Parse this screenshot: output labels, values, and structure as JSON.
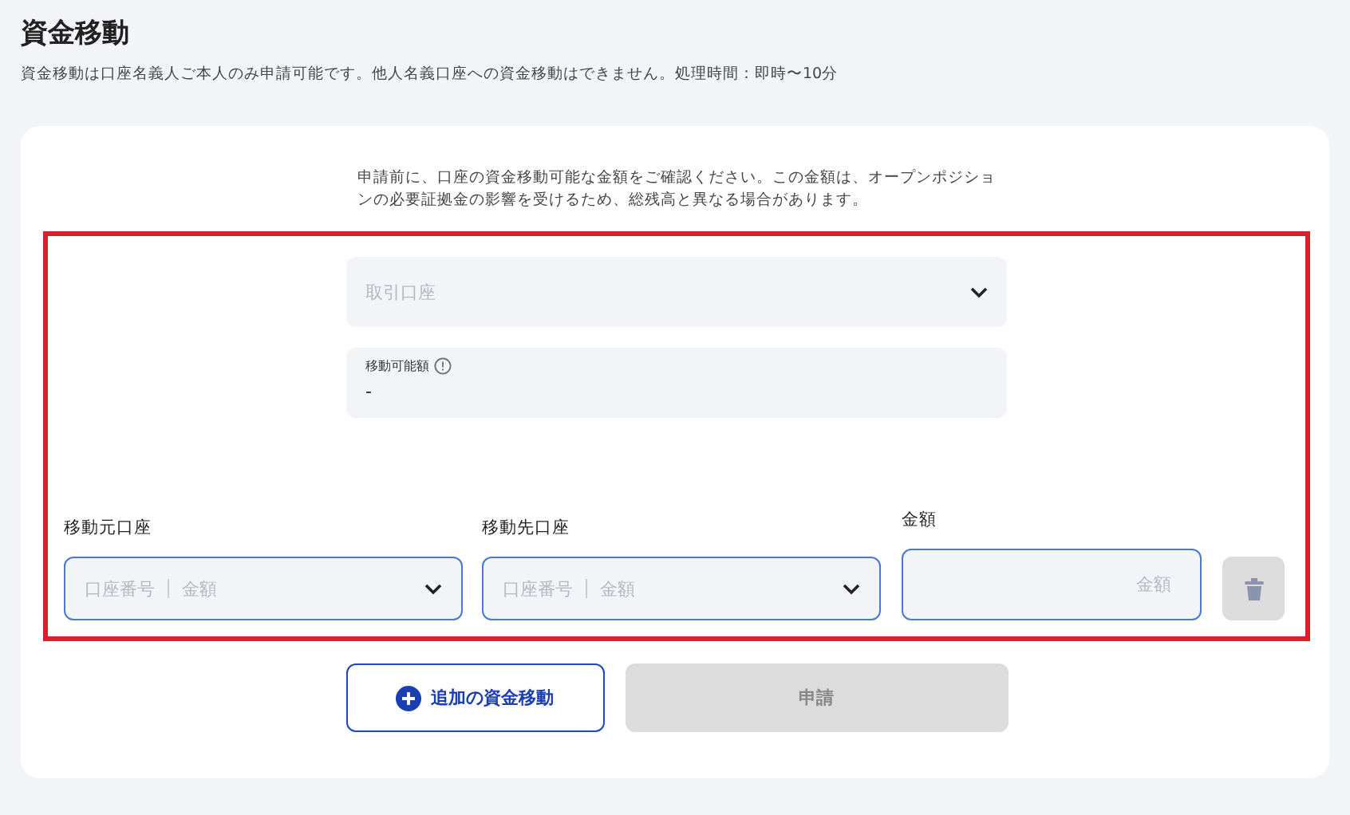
{
  "page": {
    "title": "資金移動",
    "description": "資金移動は口座名義人ご本人のみ申請可能です。他人名義口座への資金移動はできません。処理時間：即時〜10分"
  },
  "notice": "申請前に、口座の資金移動可能な金額をご確認ください。この金額は、オープンポジションの必要証拠金の影響を受けるため、総残高と異なる場合があります。",
  "highlight": true,
  "account_select": {
    "placeholder": "取引口座"
  },
  "available": {
    "label": "移動可能額",
    "value": "-"
  },
  "transfer_row": {
    "from": {
      "label": "移動元口座",
      "placeholder_number": "口座番号",
      "placeholder_amount": "金額"
    },
    "to": {
      "label": "移動先口座",
      "placeholder_number": "口座番号",
      "placeholder_amount": "金額"
    },
    "amount": {
      "label": "金額",
      "placeholder": "金額"
    },
    "delete_disabled": true
  },
  "buttons": {
    "add": "追加の資金移動",
    "submit": "申請",
    "submit_disabled": true
  }
}
